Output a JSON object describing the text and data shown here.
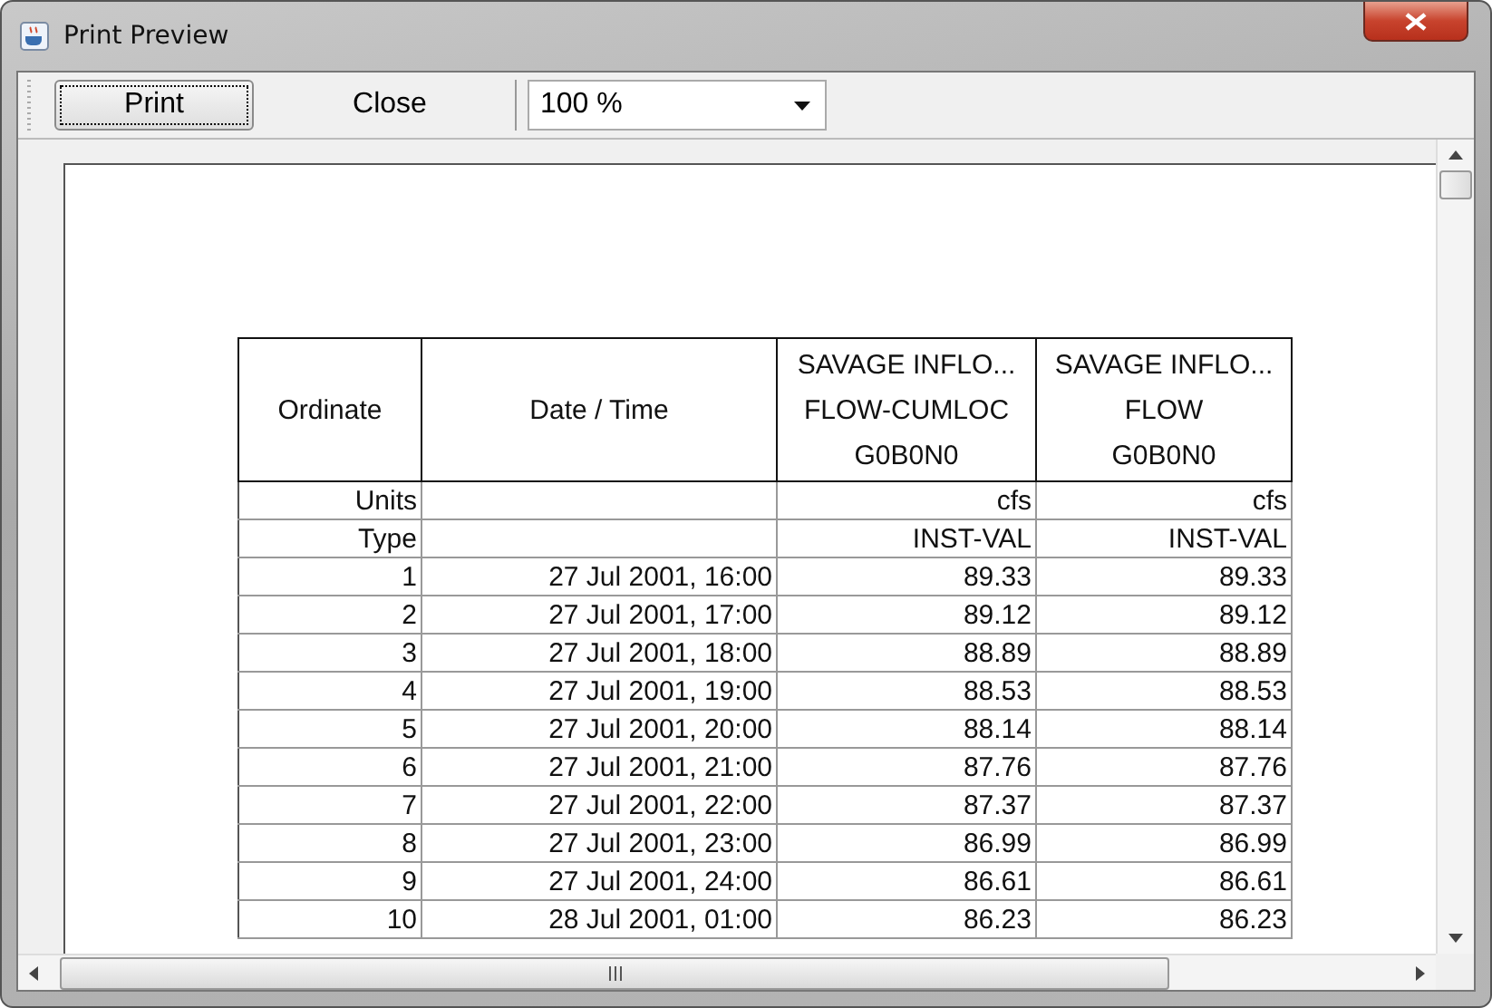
{
  "window": {
    "title": "Print Preview"
  },
  "toolbar": {
    "buttons": [
      {
        "label": "Print",
        "focused": true
      },
      {
        "label": "Close",
        "focused": false
      }
    ],
    "zoom": {
      "value": "100 %"
    }
  },
  "table": {
    "columns": [
      "Ordinate",
      "Date / Time",
      "SAVAGE INFLO...\nFLOW-CUMLOC\nG0B0N0",
      "SAVAGE INFLO...\nFLOW\nG0B0N0"
    ],
    "meta_rows": [
      [
        "Units",
        "",
        "cfs",
        "cfs"
      ],
      [
        "Type",
        "",
        "INST-VAL",
        "INST-VAL"
      ]
    ],
    "rows": [
      [
        "1",
        "27 Jul 2001, 16:00",
        "89.33",
        "89.33"
      ],
      [
        "2",
        "27 Jul 2001, 17:00",
        "89.12",
        "89.12"
      ],
      [
        "3",
        "27 Jul 2001, 18:00",
        "88.89",
        "88.89"
      ],
      [
        "4",
        "27 Jul 2001, 19:00",
        "88.53",
        "88.53"
      ],
      [
        "5",
        "27 Jul 2001, 20:00",
        "88.14",
        "88.14"
      ],
      [
        "6",
        "27 Jul 2001, 21:00",
        "87.76",
        "87.76"
      ],
      [
        "7",
        "27 Jul 2001, 22:00",
        "87.37",
        "87.37"
      ],
      [
        "8",
        "27 Jul 2001, 23:00",
        "86.99",
        "86.99"
      ],
      [
        "9",
        "27 Jul 2001, 24:00",
        "86.61",
        "86.61"
      ],
      [
        "10",
        "28 Jul 2001, 01:00",
        "86.23",
        "86.23"
      ]
    ]
  }
}
